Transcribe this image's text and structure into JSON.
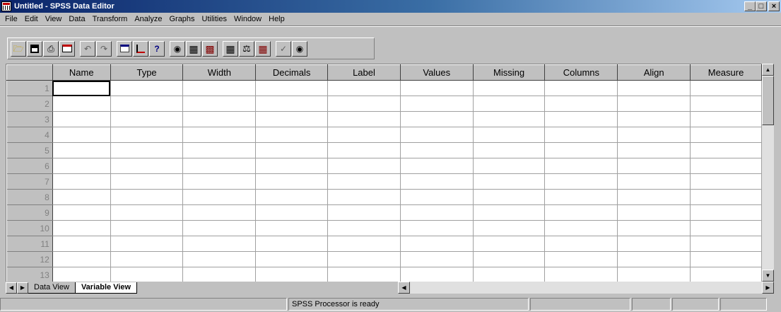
{
  "window": {
    "title": "Untitled - SPSS Data Editor",
    "controls": {
      "minimize": "_",
      "maximize": "□",
      "close": "×"
    }
  },
  "menu": [
    "File",
    "Edit",
    "View",
    "Data",
    "Transform",
    "Analyze",
    "Graphs",
    "Utilities",
    "Window",
    "Help"
  ],
  "toolbar": {
    "groups": [
      [
        "open-icon",
        "save-icon",
        "print-icon",
        "dialog-recall-icon"
      ],
      [
        "undo-icon",
        "redo-icon"
      ],
      [
        "goto-chart-icon",
        "goto-case-icon",
        "variables-icon"
      ],
      [
        "find-icon",
        "insert-case-icon",
        "insert-variable-icon"
      ],
      [
        "split-file-icon",
        "weight-cases-icon",
        "select-cases-icon"
      ],
      [
        "value-labels-icon",
        "use-sets-icon"
      ]
    ]
  },
  "grid": {
    "columns": [
      "Name",
      "Type",
      "Width",
      "Decimals",
      "Label",
      "Values",
      "Missing",
      "Columns",
      "Align",
      "Measure"
    ],
    "rows": [
      "1",
      "2",
      "3",
      "4",
      "5",
      "6",
      "7",
      "8",
      "9",
      "10",
      "11",
      "12",
      "13"
    ],
    "selected_cell": {
      "row": 1,
      "column": "Name"
    }
  },
  "tabs": {
    "data_view": "Data View",
    "variable_view": "Variable View",
    "active": "Variable View"
  },
  "status": {
    "processor": "SPSS Processor  is ready"
  }
}
